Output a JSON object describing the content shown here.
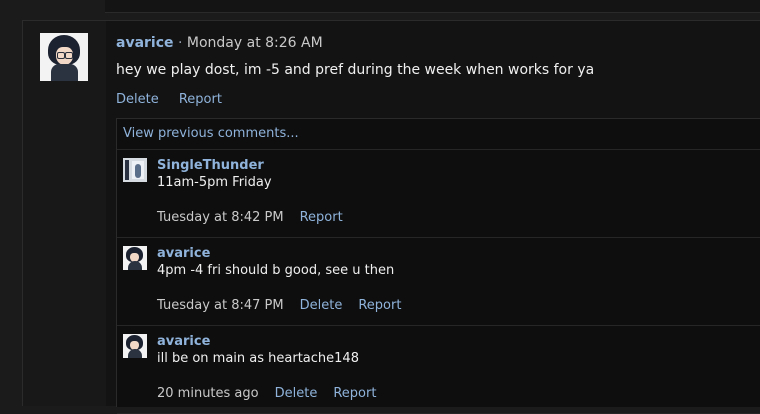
{
  "post": {
    "author": "avarice",
    "separator": " · ",
    "time": "Monday at 8:26 AM",
    "message": "hey we play dost, im -5 and pref during the week when works for ya",
    "actions": {
      "delete": "Delete",
      "report": "Report"
    }
  },
  "comments": {
    "view_previous": "View previous comments...",
    "items": [
      {
        "author": "SingleThunder",
        "text": "11am-5pm Friday",
        "time": "Tuesday at 8:42 PM",
        "delete": "",
        "report": "Report"
      },
      {
        "author": "avarice",
        "text": "4pm -4 fri should b good, see u then",
        "time": "Tuesday at 8:47 PM",
        "delete": "Delete",
        "report": "Report"
      },
      {
        "author": "avarice",
        "text": "ill be on main as heartache148",
        "time": "20 minutes ago",
        "delete": "Delete",
        "report": "Report"
      }
    ]
  },
  "icons": {
    "main_avatar": "avatar-anime-girl",
    "comment_avatar_alt": "avatar-single-thunder"
  },
  "colors": {
    "link": "#8fb3db",
    "background": "#131313",
    "comment_bg": "#0e0e0e"
  }
}
